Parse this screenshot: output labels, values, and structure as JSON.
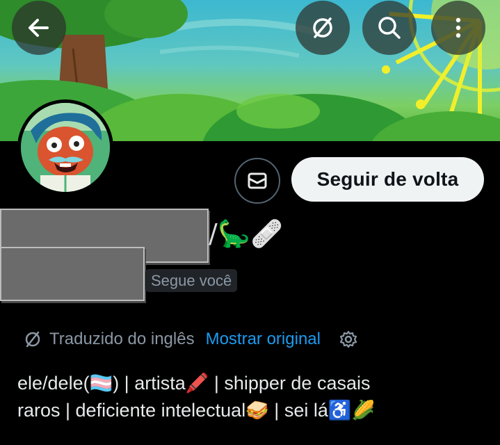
{
  "header": {
    "back_icon": "arrow-left-icon",
    "translate_icon": "translate-slash-icon",
    "search_icon": "search-icon",
    "more_icon": "more-vertical-icon"
  },
  "profile": {
    "name_emoji": "/🦕🩹",
    "follows_you": "Segue você"
  },
  "actions": {
    "message_icon": "mail-icon",
    "follow_back_label": "Seguir de volta"
  },
  "translation": {
    "label": "Traduzido do inglês",
    "show_original": "Mostrar original",
    "settings_icon": "gear-icon"
  },
  "bio": {
    "line1": "ele/dele(🏳️‍⚧️) | artista🖍️ | shipper de casais",
    "line2": "raros | deficiente intelectual🥪 | sei lá♿🌽"
  },
  "colors": {
    "background": "#000000",
    "accent": "#1d9bf0",
    "button_bg": "#eff3f4",
    "muted_text": "#8b98a5"
  }
}
